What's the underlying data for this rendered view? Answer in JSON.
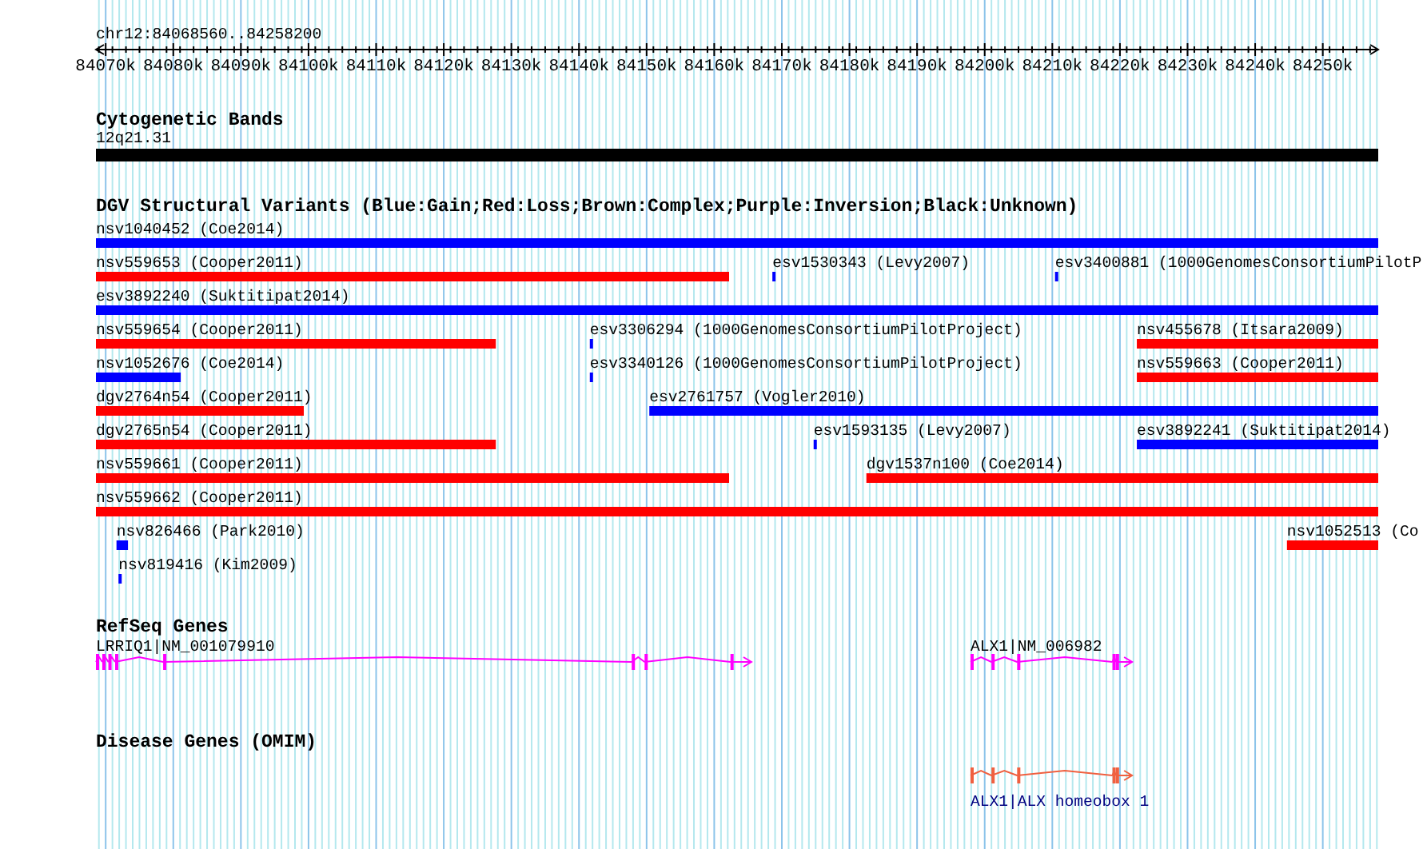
{
  "ruler": {
    "title": "chr12:84068560..84258200",
    "ticks": [
      "84070k",
      "84080k",
      "84090k",
      "84100k",
      "84110k",
      "84120k",
      "84130k",
      "84140k",
      "84150k",
      "84160k",
      "84170k",
      "84180k",
      "84190k",
      "84200k",
      "84210k",
      "84220k",
      "84230k",
      "84240k",
      "84250k"
    ]
  },
  "tracks": [
    {
      "title": "Cytogenetic Bands",
      "kind": "band",
      "features": [
        {
          "label": "12q21.31",
          "color": "#000000"
        }
      ]
    },
    {
      "title": "DGV Structural Variants (Blue:Gain;Red:Loss;Brown:Complex;Purple:Inversion;Black:Unknown)",
      "kind": "variants",
      "rows": [
        [
          {
            "label": "nsv1040452 (Coe2014)",
            "color": "#0000ff"
          }
        ],
        [
          {
            "label": "nsv559653 (Cooper2011)",
            "color": "#ff0000"
          },
          {
            "label": "esv1530343 (Levy2007)",
            "color": "#0000ff"
          },
          {
            "label": "esv3400881 (1000GenomesConsortiumPilotP",
            "color": "#0000ff"
          }
        ],
        [
          {
            "label": "esv3892240 (Suktitipat2014)",
            "color": "#0000ff"
          }
        ],
        [
          {
            "label": "nsv559654 (Cooper2011)",
            "color": "#ff0000"
          },
          {
            "label": "esv3306294 (1000GenomesConsortiumPilotProject)",
            "color": "#0000ff"
          },
          {
            "label": "nsv455678 (Itsara2009)",
            "color": "#ff0000"
          }
        ],
        [
          {
            "label": "nsv1052676 (Coe2014)",
            "color": "#0000ff"
          },
          {
            "label": "esv3340126 (1000GenomesConsortiumPilotProject)",
            "color": "#0000ff"
          },
          {
            "label": "nsv559663 (Cooper2011)",
            "color": "#ff0000"
          }
        ],
        [
          {
            "label": "dgv2764n54 (Cooper2011)",
            "color": "#ff0000"
          },
          {
            "label": "esv2761757 (Vogler2010)",
            "color": "#0000ff"
          }
        ],
        [
          {
            "label": "dgv2765n54 (Cooper2011)",
            "color": "#ff0000"
          },
          {
            "label": "esv1593135 (Levy2007)",
            "color": "#0000ff"
          },
          {
            "label": "esv3892241 (Suktitipat2014)",
            "color": "#0000ff"
          }
        ],
        [
          {
            "label": "nsv559661 (Cooper2011)",
            "color": "#ff0000"
          },
          {
            "label": "dgv1537n100 (Coe2014)",
            "color": "#ff0000"
          }
        ],
        [
          {
            "label": "nsv559662 (Cooper2011)",
            "color": "#ff0000"
          }
        ],
        [
          {
            "label": "nsv826466 (Park2010)",
            "color": "#0000ff"
          },
          {
            "label": "nsv1052513 (Co",
            "color": "#ff0000"
          }
        ],
        [
          {
            "label": "nsv819416 (Kim2009)",
            "color": "#0000ff"
          }
        ]
      ]
    },
    {
      "title": "RefSeq Genes",
      "kind": "gene",
      "features": [
        {
          "label": "LRRIQ1|NM_001079910",
          "color": "#ff00ff"
        },
        {
          "label": "ALX1|NM_006982",
          "color": "#ff00ff"
        }
      ]
    },
    {
      "title": "Disease Genes (OMIM)",
      "kind": "disease",
      "features": [
        {
          "label": "ALX1|ALX homeobox 1",
          "color": "#f06040"
        }
      ]
    }
  ]
}
